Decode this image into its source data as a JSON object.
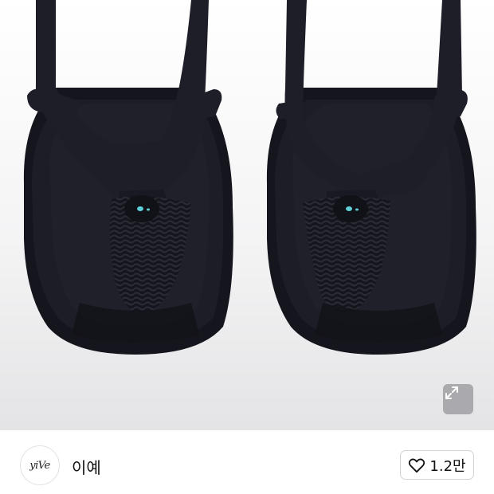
{
  "product": {
    "image_alt_icon": "sandal-product-photo",
    "expand_icon": "expand-arrows-icon"
  },
  "seller": {
    "avatar_logo_text": "yiVe",
    "name": "이예"
  },
  "like": {
    "icon": "heart-outline-icon",
    "count": "1.2만"
  },
  "colors": {
    "sandal": "#1a1b24",
    "background": "#ededef",
    "teal_accent": "#5fd0d8"
  }
}
